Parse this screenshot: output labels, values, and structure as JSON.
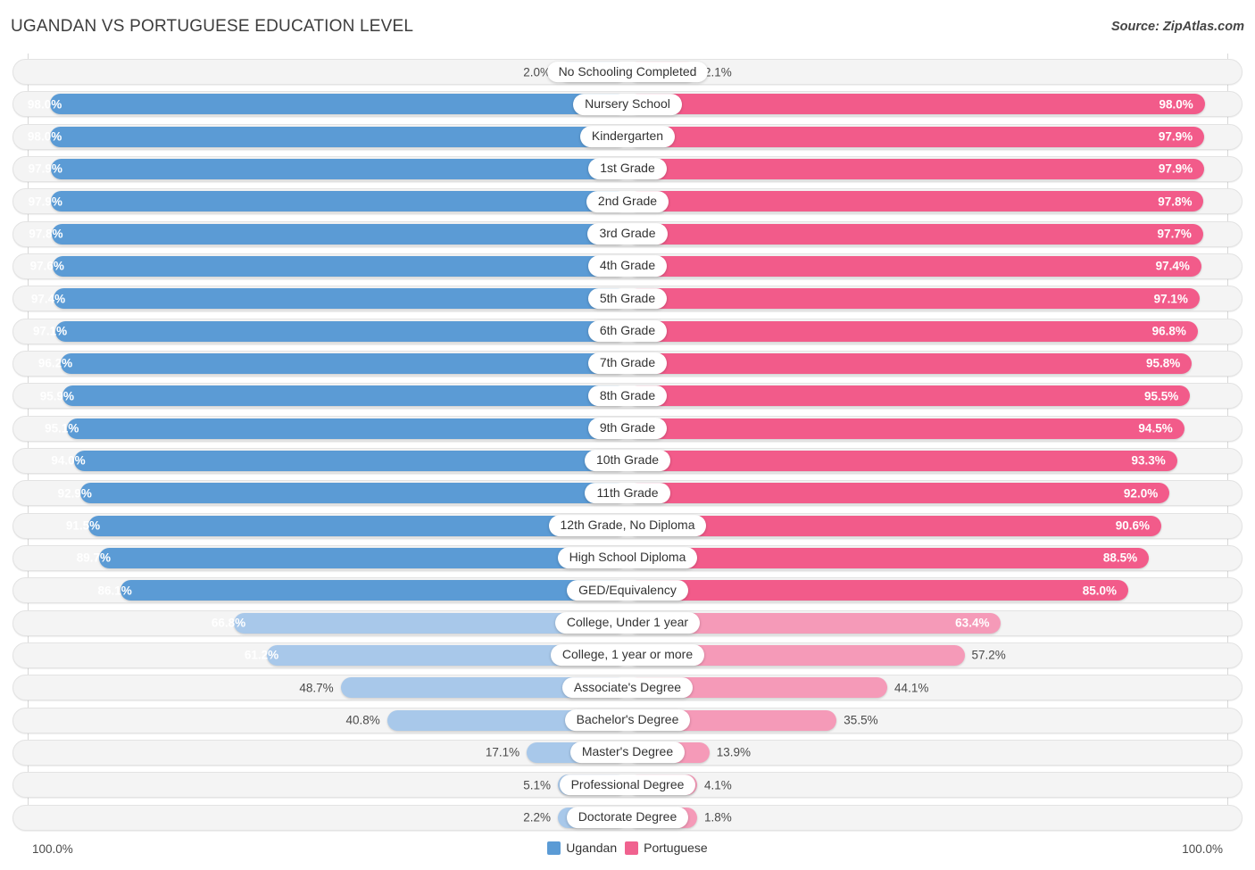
{
  "header": {
    "title": "UGANDAN VS PORTUGUESE EDUCATION LEVEL",
    "source": "Source: ZipAtlas.com"
  },
  "legend": {
    "items": [
      {
        "label": "Ugandan",
        "color": "#5b9bd5"
      },
      {
        "label": "Portuguese",
        "color": "#f0628f"
      }
    ]
  },
  "axis": {
    "left_max": "100.0%",
    "right_max": "100.0%"
  },
  "colors": {
    "ugandan_strong": "#5b9bd5",
    "ugandan_light": "#a8c8ea",
    "portuguese_strong": "#f25b8a",
    "portuguese_light": "#f59ab8",
    "track": "#f4f4f4",
    "track_border": "#e3e3e3"
  },
  "chart_data": {
    "type": "bar",
    "orientation": "horizontal-diverging",
    "title": "UGANDAN VS PORTUGUESE EDUCATION LEVEL",
    "xlabel": "",
    "ylabel": "",
    "xlim": [
      0,
      100
    ],
    "grid": false,
    "legend_position": "bottom-center",
    "value_suffix": "%",
    "categories": [
      "No Schooling Completed",
      "Nursery School",
      "Kindergarten",
      "1st Grade",
      "2nd Grade",
      "3rd Grade",
      "4th Grade",
      "5th Grade",
      "6th Grade",
      "7th Grade",
      "8th Grade",
      "9th Grade",
      "10th Grade",
      "11th Grade",
      "12th Grade, No Diploma",
      "High School Diploma",
      "GED/Equivalency",
      "College, Under 1 year",
      "College, 1 year or more",
      "Associate's Degree",
      "Bachelor's Degree",
      "Master's Degree",
      "Professional Degree",
      "Doctorate Degree"
    ],
    "series": [
      {
        "name": "Ugandan",
        "color": "#5b9bd5",
        "values": [
          2.0,
          98.0,
          98.0,
          97.9,
          97.9,
          97.8,
          97.6,
          97.4,
          97.1,
          96.2,
          95.9,
          95.1,
          94.0,
          92.9,
          91.5,
          89.7,
          86.1,
          66.8,
          61.2,
          48.7,
          40.8,
          17.1,
          5.1,
          2.2
        ],
        "labels": [
          "2.0%",
          "98.0%",
          "98.0%",
          "97.9%",
          "97.9%",
          "97.8%",
          "97.6%",
          "97.4%",
          "97.1%",
          "96.2%",
          "95.9%",
          "95.1%",
          "94.0%",
          "92.9%",
          "91.5%",
          "89.7%",
          "86.1%",
          "66.8%",
          "61.2%",
          "48.7%",
          "40.8%",
          "17.1%",
          "5.1%",
          "2.2%"
        ]
      },
      {
        "name": "Portuguese",
        "color": "#f25b8a",
        "values": [
          2.1,
          98.0,
          97.9,
          97.9,
          97.8,
          97.7,
          97.4,
          97.1,
          96.8,
          95.8,
          95.5,
          94.5,
          93.3,
          92.0,
          90.6,
          88.5,
          85.0,
          63.4,
          57.2,
          44.1,
          35.5,
          13.9,
          4.1,
          1.8
        ],
        "labels": [
          "2.1%",
          "98.0%",
          "97.9%",
          "97.9%",
          "97.8%",
          "97.7%",
          "97.4%",
          "97.1%",
          "96.8%",
          "95.8%",
          "95.5%",
          "94.5%",
          "93.3%",
          "92.0%",
          "90.6%",
          "88.5%",
          "85.0%",
          "63.4%",
          "57.2%",
          "44.1%",
          "35.5%",
          "13.9%",
          "4.1%",
          "1.8%"
        ]
      }
    ]
  }
}
